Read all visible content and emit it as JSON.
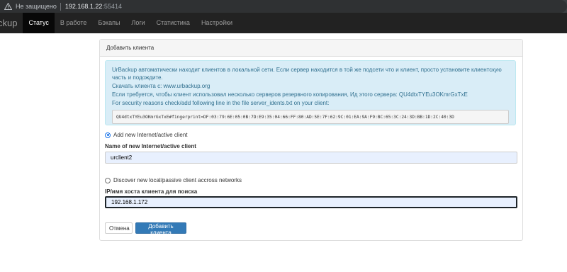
{
  "browser": {
    "security_label": "Не защищено",
    "host": "192.168.1.22",
    "port": ":55414",
    "warn_color": "#bdc1c6"
  },
  "navbar": {
    "brand": "ckup",
    "items": [
      {
        "label": "Статус",
        "active": true
      },
      {
        "label": "В работе",
        "active": false
      },
      {
        "label": "Бэкапы",
        "active": false
      },
      {
        "label": "Логи",
        "active": false
      },
      {
        "label": "Статистика",
        "active": false
      },
      {
        "label": "Настройки",
        "active": false
      }
    ]
  },
  "panel": {
    "title": "Добавить клиента",
    "info": {
      "line1": "UrBackup автоматически находит клиентов в локальной сети. Если сервер находится в той же подсети что и клиент, просто установите клиентскую часть и подождите.",
      "download_prefix": "Скачать клиента с: ",
      "download_link": "www.urbackup.org",
      "line3": "Если требуется, чтобы клиент использовал несколько серверов резервного копирования, Ид этого сервера: QU4dtxTYEu3OKmrGxTxE",
      "line4": "For security reasons check/add following line in the file server_idents.txt on your client:",
      "ident": "QU4dtxTYEu3OKmrGxTxE#fingerprint=DF:03:79:6E:05:0B:7D:E9:35:04:66:FF:80:AD:5E:7F:62:9C:01:EA:9A:F9:BC:65:3C:24:3D:BB:1D:2C:40:3D"
    },
    "internet_option": "Add new Internet/active client",
    "internet_name_label": "Name of new Internet/active client",
    "internet_name_value": "urclient2",
    "local_option": "Discover new local/passive client accross networks",
    "ip_label": "IP/имя хоста клиента для поиска",
    "ip_value": "192.168.1.172",
    "cancel_label": "Отмена",
    "add_label": "Добавить клиента"
  }
}
